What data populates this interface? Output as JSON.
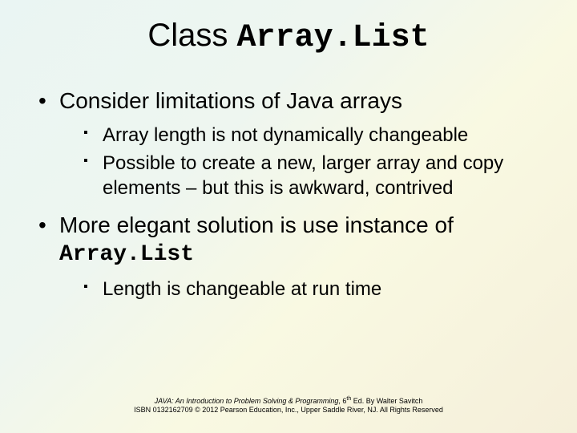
{
  "title": {
    "prefix": "Class ",
    "mono": "Array.List"
  },
  "bullets": [
    {
      "text": "Consider limitations of Java arrays",
      "sub": [
        "Array length is not dynamically changeable",
        "Possible to create a new, larger array and copy elements – but this is awkward, contrived"
      ]
    },
    {
      "text": "More elegant solution is use instance of",
      "mono": "Array.List",
      "sub": [
        "Length is changeable at run time"
      ]
    }
  ],
  "footer": {
    "book": "JAVA: An Introduction to Problem Solving & Programming",
    "edition": ", 6",
    "sup": "th",
    "byline": " Ed. By Walter Savitch",
    "line2": "ISBN 0132162709 © 2012 Pearson Education, Inc., Upper Saddle River, NJ. All Rights Reserved"
  }
}
